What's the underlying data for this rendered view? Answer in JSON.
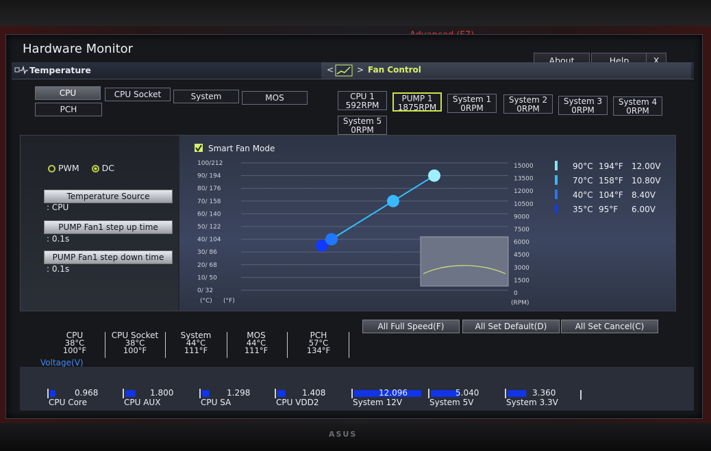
{
  "bios": {
    "top_menu": "Advanced (F7)"
  },
  "monitor_brand": "ASUS",
  "window": {
    "title": "Hardware Monitor",
    "buttons": [
      {
        "label": "About"
      },
      {
        "label": "Help"
      },
      {
        "label": "X"
      }
    ]
  },
  "temperature": {
    "header": "Temperature",
    "categories": [
      {
        "label": "CPU",
        "active": true
      },
      {
        "label": "CPU Socket",
        "active": false
      },
      {
        "label": "System",
        "active": false
      },
      {
        "label": "MOS",
        "active": false
      },
      {
        "label": "PCH",
        "active": false
      }
    ]
  },
  "fan_control": {
    "header": "Fan Control",
    "nav_left": "<",
    "nav_right": ">",
    "fans": [
      {
        "name": "CPU 1",
        "rpm": "592RPM",
        "active": false
      },
      {
        "name": "PUMP 1",
        "rpm": "1875RPM",
        "active": true
      },
      {
        "name": "System 1",
        "rpm": "0RPM",
        "active": false
      },
      {
        "name": "System 2",
        "rpm": "0RPM",
        "active": false
      },
      {
        "name": "System 3",
        "rpm": "0RPM",
        "active": false
      },
      {
        "name": "System 4",
        "rpm": "0RPM",
        "active": false
      },
      {
        "name": "System 5",
        "rpm": "0RPM",
        "active": false
      }
    ]
  },
  "settings": {
    "mode_pwm": "PWM",
    "mode_dc": "DC",
    "selected_mode": "DC",
    "temperature_source_label": "Temperature Source",
    "temperature_source_value": ": CPU",
    "step_up_label": "PUMP Fan1 step up time",
    "step_up_value": ": 0.1s",
    "step_down_label": "PUMP Fan1 step down time",
    "step_down_value": ": 0.1s"
  },
  "chart_data": {
    "type": "line",
    "title": "Smart Fan Mode",
    "smart_fan_checked": true,
    "y_left_ticks": [
      "100/212",
      "90/ 194",
      "80/ 176",
      "70/ 158",
      "60/ 140",
      "50/ 122",
      "40/ 104",
      "30/  86",
      "20/  68",
      "10/  50",
      "0/  32"
    ],
    "y_right_ticks": [
      "15000",
      "13500",
      "12000",
      "10500",
      "9000",
      "7500",
      "6000",
      "4500",
      "3000",
      "1500",
      "0"
    ],
    "xlabel_left": "(°C)",
    "xlabel_right": "(°F)",
    "unit_rpm": "(RPM)",
    "ylim_temperature_c": [
      0,
      100
    ],
    "points": [
      {
        "temp_c": 35,
        "temp_f": 95,
        "voltage": "6.00V"
      },
      {
        "temp_c": 40,
        "temp_f": 104,
        "voltage": "8.40V"
      },
      {
        "temp_c": 70,
        "temp_f": 158,
        "voltage": "10.80V"
      },
      {
        "temp_c": 90,
        "temp_f": 194,
        "voltage": "12.00V"
      }
    ],
    "legend": [
      {
        "c": "90°C",
        "f": "194°F",
        "v": "12.00V",
        "color": "#7fe6ff"
      },
      {
        "c": "70°C",
        "f": "158°F",
        "v": "10.80V",
        "color": "#38b8ff"
      },
      {
        "c": "40°C",
        "f": "104°F",
        "v": "8.40V",
        "color": "#1f78ff"
      },
      {
        "c": "35°C",
        "f": "95°F",
        "v": "6.00V",
        "color": "#1239ff"
      }
    ],
    "grid": true
  },
  "actions": [
    {
      "label": "All Full Speed(F)"
    },
    {
      "label": "All Set Default(D)"
    },
    {
      "label": "All Set Cancel(C)"
    }
  ],
  "current_temps": [
    {
      "name": "CPU",
      "c": "38°C",
      "f": "100°F"
    },
    {
      "name": "CPU Socket",
      "c": "38°C",
      "f": "100°F"
    },
    {
      "name": "System",
      "c": "44°C",
      "f": "111°F"
    },
    {
      "name": "MOS",
      "c": "44°C",
      "f": "111°F"
    },
    {
      "name": "PCH",
      "c": "57°C",
      "f": "134°F"
    }
  ],
  "voltage": {
    "label": "Voltage(V)",
    "items": [
      {
        "name": "CPU Core",
        "value": "0.968",
        "fill": 0.08
      },
      {
        "name": "CPU AUX",
        "value": "1.800",
        "fill": 0.15
      },
      {
        "name": "CPU SA",
        "value": "1.298",
        "fill": 0.11
      },
      {
        "name": "CPU VDD2",
        "value": "1.408",
        "fill": 0.12
      },
      {
        "name": "System 12V",
        "value": "12.096",
        "fill": 1.0
      },
      {
        "name": "System 5V",
        "value": "5.040",
        "fill": 0.42
      },
      {
        "name": "System 3.3V",
        "value": "3.360",
        "fill": 0.28
      }
    ]
  }
}
